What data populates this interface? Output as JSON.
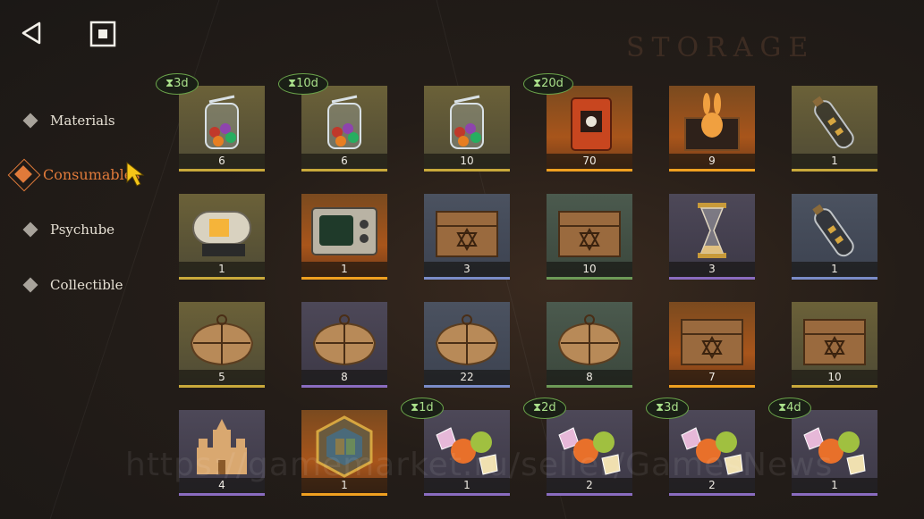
{
  "header": {
    "back_icon": "back-triangle-icon",
    "stop_icon": "stop-square-icon",
    "section_title": "STORAGE"
  },
  "sidebar": {
    "items": [
      {
        "label": "Materials",
        "active": false
      },
      {
        "label": "Consumables",
        "active": true
      },
      {
        "label": "Psychube",
        "active": false
      },
      {
        "label": "Collectible",
        "active": false
      }
    ]
  },
  "colors": {
    "accent": "#e07a3a",
    "timer_border": "#6aa34a",
    "timer_text": "#a9e08a",
    "rarity_gold": "#c9a93b",
    "rarity_orange": "#f0a020",
    "rarity_blue": "#7a8cc8",
    "rarity_green": "#6d9a57",
    "rarity_purple": "#8a6cc0"
  },
  "items": [
    {
      "name": "jar-of-candies",
      "count": "6",
      "rarity": "gold",
      "timer": "3d"
    },
    {
      "name": "jar-of-candies",
      "count": "6",
      "rarity": "gold",
      "timer": "10d"
    },
    {
      "name": "jar-of-candies",
      "count": "10",
      "rarity": "gold",
      "timer": ""
    },
    {
      "name": "ticket-book",
      "count": "70",
      "rarity": "orange",
      "timer": "20d"
    },
    {
      "name": "rabbit-gift-box",
      "count": "9",
      "rarity": "orange",
      "timer": ""
    },
    {
      "name": "bottle-ship",
      "count": "1",
      "rarity": "gold",
      "timer": ""
    },
    {
      "name": "capsule-machine",
      "count": "1",
      "rarity": "gold",
      "timer": ""
    },
    {
      "name": "old-tv",
      "count": "1",
      "rarity": "orange",
      "timer": ""
    },
    {
      "name": "wooden-crate",
      "count": "3",
      "rarity": "blue",
      "timer": ""
    },
    {
      "name": "wooden-crate",
      "count": "10",
      "rarity": "green",
      "timer": ""
    },
    {
      "name": "hourglass",
      "count": "3",
      "rarity": "purple",
      "timer": ""
    },
    {
      "name": "bottle-ship",
      "count": "1",
      "rarity": "blue",
      "timer": ""
    },
    {
      "name": "wrapped-parcel",
      "count": "5",
      "rarity": "gold",
      "timer": ""
    },
    {
      "name": "wrapped-parcel",
      "count": "8",
      "rarity": "purple",
      "timer": ""
    },
    {
      "name": "wrapped-parcel",
      "count": "22",
      "rarity": "blue",
      "timer": ""
    },
    {
      "name": "wrapped-parcel",
      "count": "8",
      "rarity": "green",
      "timer": ""
    },
    {
      "name": "wooden-crate",
      "count": "7",
      "rarity": "orange",
      "timer": ""
    },
    {
      "name": "wooden-crate",
      "count": "10",
      "rarity": "gold",
      "timer": ""
    },
    {
      "name": "sand-castle",
      "count": "4",
      "rarity": "purple",
      "timer": ""
    },
    {
      "name": "stained-glass-token",
      "count": "1",
      "rarity": "orange",
      "timer": ""
    },
    {
      "name": "fruit-candies",
      "count": "1",
      "rarity": "purple",
      "timer": "1d"
    },
    {
      "name": "fruit-candies",
      "count": "2",
      "rarity": "purple",
      "timer": "2d"
    },
    {
      "name": "fruit-candies",
      "count": "2",
      "rarity": "purple",
      "timer": "3d"
    },
    {
      "name": "fruit-candies",
      "count": "1",
      "rarity": "purple",
      "timer": "4d"
    }
  ],
  "watermark": "https://gamemarket.ru/seller/GamesNews"
}
